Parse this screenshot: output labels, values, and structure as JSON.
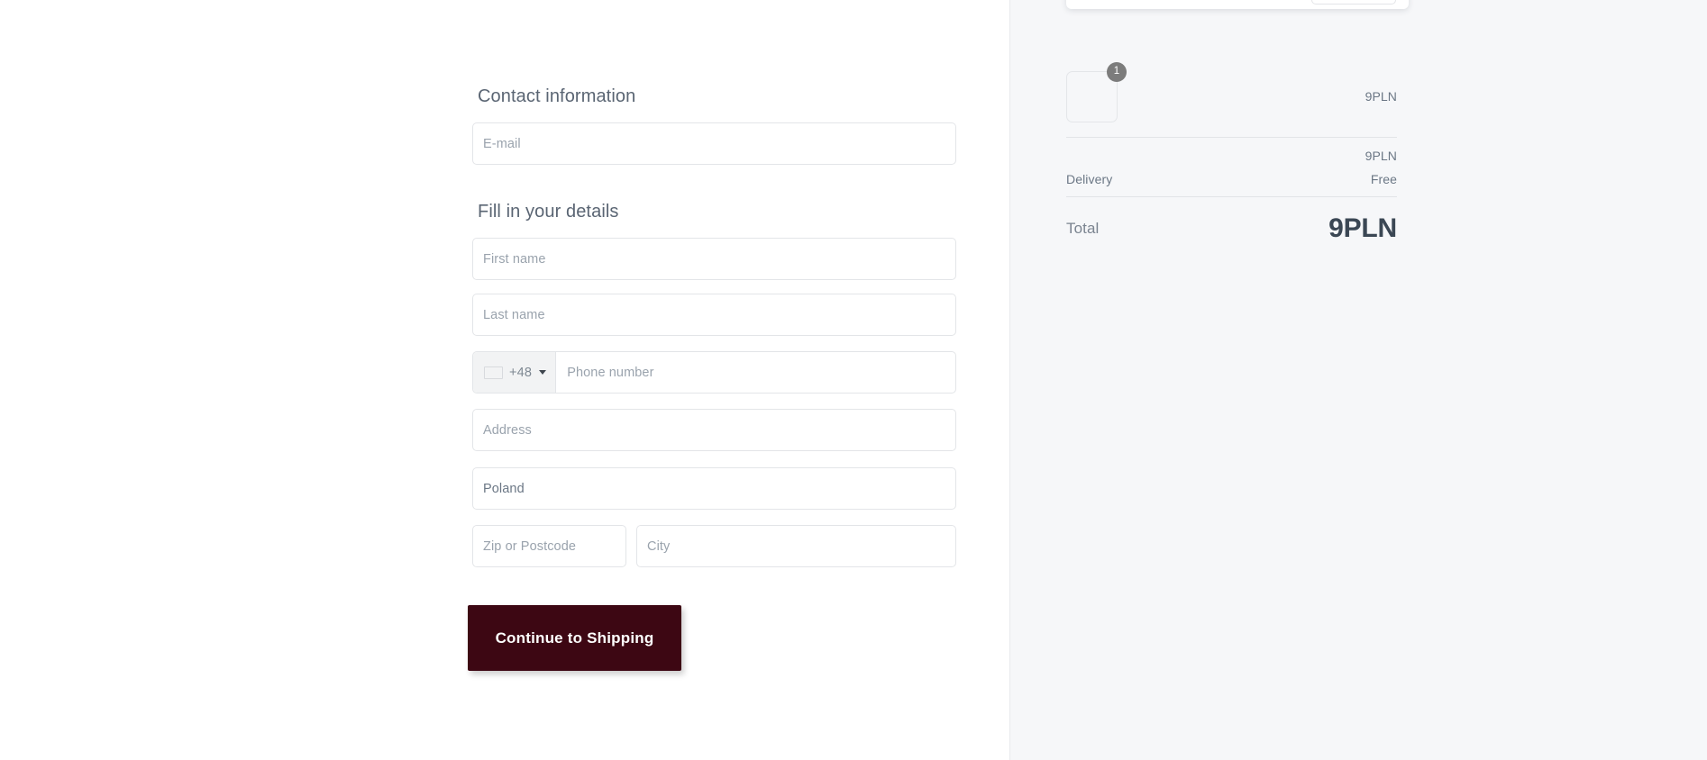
{
  "checkout": {
    "contact": {
      "heading": "Contact information",
      "email_placeholder": "E-mail",
      "email_value": ""
    },
    "details": {
      "heading": "Fill in your details",
      "first_name_placeholder": "First name",
      "first_name_value": "",
      "last_name_placeholder": "Last name",
      "last_name_value": "",
      "phone": {
        "flag": "poland-flag-icon",
        "dial_code": "+48",
        "dropdown_icon": "chevron-down-icon",
        "placeholder": "Phone number",
        "value": ""
      },
      "address_placeholder": "Address",
      "address_value": "",
      "country_value": "Poland",
      "zip_placeholder": "Zip or Postcode",
      "zip_value": "",
      "city_placeholder": "City",
      "city_value": ""
    },
    "submit_label": "Continue to Shipping"
  },
  "summary": {
    "item": {
      "quantity_badge": "1",
      "name": "",
      "price": "9PLN"
    },
    "subtotal": {
      "label": "",
      "value": "9PLN"
    },
    "delivery": {
      "label": "Delivery",
      "value": "Free"
    },
    "total": {
      "label": "Total",
      "value": "9PLN"
    }
  },
  "colors": {
    "submit_button_bg": "#3d0713",
    "summary_panel_bg": "#f6f7f9",
    "flag_red": "#dc143c",
    "badge_bg": "#7c7c7c"
  }
}
